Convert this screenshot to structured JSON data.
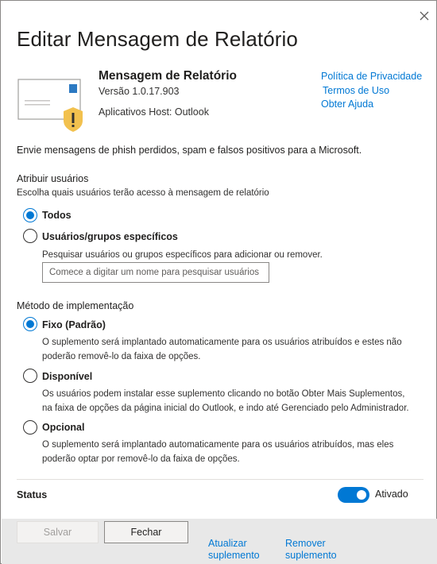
{
  "dialog": {
    "title": "Editar Mensagem de Relatório",
    "close_icon": "close-icon"
  },
  "app": {
    "name": "Mensagem de Relatório",
    "version": "Versão 1.0.17.903",
    "hosts": "Aplicativos Host: Outlook",
    "icon": "envelope-warning-icon"
  },
  "links": {
    "privacy": "Política de Privacidade",
    "terms": "Termos de Uso",
    "help": "Obter Ajuda"
  },
  "description": "Envie mensagens de phish perdidos, spam e falsos positivos para a Microsoft.",
  "assign": {
    "title": "Atribuir usuários",
    "subtitle": "Escolha quais usuários terão acesso à mensagem de relatório",
    "options": [
      {
        "label": "Todos",
        "checked": true
      },
      {
        "label": "Usuários/grupos específicos",
        "checked": false
      }
    ],
    "search_help": "Pesquisar usuários ou grupos específicos para adicionar ou remover.",
    "search_placeholder": "Comece a digitar um nome para pesquisar usuários"
  },
  "deploy": {
    "title": "Método de implementação",
    "options": [
      {
        "label": "Fixo (Padrão)",
        "checked": true,
        "help": "O suplemento será implantado automaticamente para os usuários atribuídos e estes não poderão removê-lo da faixa de opções."
      },
      {
        "label": "Disponível",
        "checked": false,
        "help": "Os usuários podem instalar esse suplemento clicando no botão Obter Mais Suplementos, na faixa de opções da página inicial do Outlook, e indo até Gerenciado pelo Administrador."
      },
      {
        "label": "Opcional",
        "checked": false,
        "help": "O suplemento será implantado automaticamente para os usuários atribuídos, mas eles poderão optar por removê-lo da faixa de opções."
      }
    ]
  },
  "status": {
    "label": "Status",
    "on": true,
    "value": "Ativado"
  },
  "footer": {
    "save": "Salvar",
    "close": "Fechar",
    "update": "Atualizar suplemento",
    "remove": "Remover suplemento"
  },
  "colors": {
    "accent": "#0078d4",
    "footer_bg": "#e8e8e8",
    "warning": "#f2c14e"
  }
}
